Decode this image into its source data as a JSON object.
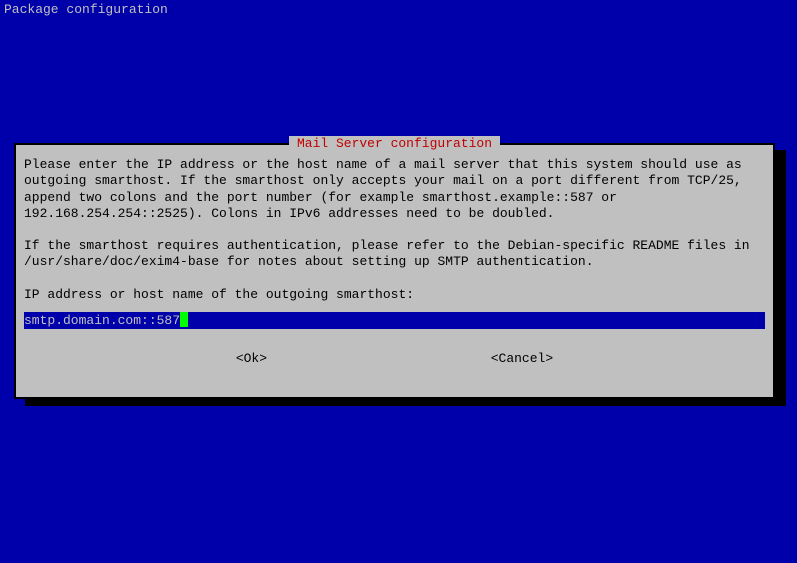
{
  "header": {
    "title": "Package configuration"
  },
  "dialog": {
    "title": "Mail Server configuration",
    "body_p1": "Please enter the IP address or the host name of a mail server that this system should use as outgoing smarthost. If the smarthost only accepts your mail on a port different from TCP/25, append two colons and the port number (for example smarthost.example::587 or 192.168.254.254::2525). Colons in IPv6 addresses need to be doubled.",
    "body_p2": "If the smarthost requires authentication, please refer to the Debian-specific README files in /usr/share/doc/exim4-base for notes about setting up SMTP authentication.",
    "prompt": "IP address or host name of the outgoing smarthost:",
    "input_value": "smtp.domain.com::587",
    "ok_label": "<Ok>",
    "cancel_label": "<Cancel>"
  }
}
